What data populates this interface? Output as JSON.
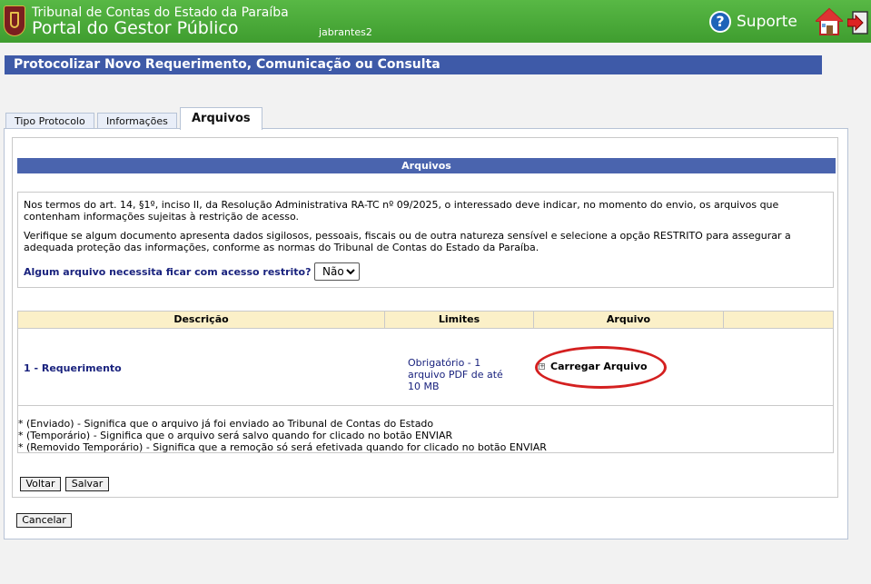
{
  "header": {
    "org": "Tribunal de Contas do Estado da Paraíba",
    "portal": "Portal do Gestor Público",
    "user": "jabrantes2",
    "support_label": "Suporte"
  },
  "page_title": "Protocolizar Novo Requerimento, Comunicação ou Consulta",
  "tabs": [
    {
      "label": "Tipo Protocolo"
    },
    {
      "label": "Informações"
    },
    {
      "label": "Arquivos"
    }
  ],
  "section": {
    "title": "Arquivos",
    "notice_p1": "Nos termos do art. 14, §1º, inciso II, da Resolução Administrativa RA-TC nº 09/2025, o interessado deve indicar, no momento do envio, os arquivos que contenham informações sujeitas à restrição de acesso.",
    "notice_p2": "Verifique se algum documento apresenta dados sigilosos, pessoais, fiscais ou de outra natureza sensível e selecione a opção RESTRITO para assegurar a adequada proteção das informações, conforme as normas do Tribunal de Contas do Estado da Paraíba.",
    "restrict_question": "Algum arquivo necessita ficar com acesso restrito?",
    "restrict_value": "Não"
  },
  "table": {
    "headers": [
      "Descrição",
      "Limites",
      "Arquivo"
    ],
    "rows": [
      {
        "descricao": "1 - Requerimento",
        "limites": "Obrigatório - 1 arquivo PDF de até 10 MB",
        "arquivo": "Carregar Arquivo"
      }
    ],
    "legend": [
      "* (Enviado) - Significa que o arquivo já foi enviado ao Tribunal de Contas do Estado",
      "* (Temporário) - Significa que o arquivo será salvo quando for clicado no botão ENVIAR",
      "* (Removido Temporário) - Significa que a remoção só será efetivada quando for clicado no botão ENVIAR"
    ]
  },
  "buttons": {
    "voltar": "Voltar",
    "salvar": "Salvar",
    "cancelar": "Cancelar"
  },
  "colors": {
    "header_green": "#4caf3a",
    "title_blue": "#3e5aa8",
    "section_blue": "#4a64ae",
    "table_head": "#fbf0c8",
    "highlight_red": "#d42020"
  }
}
